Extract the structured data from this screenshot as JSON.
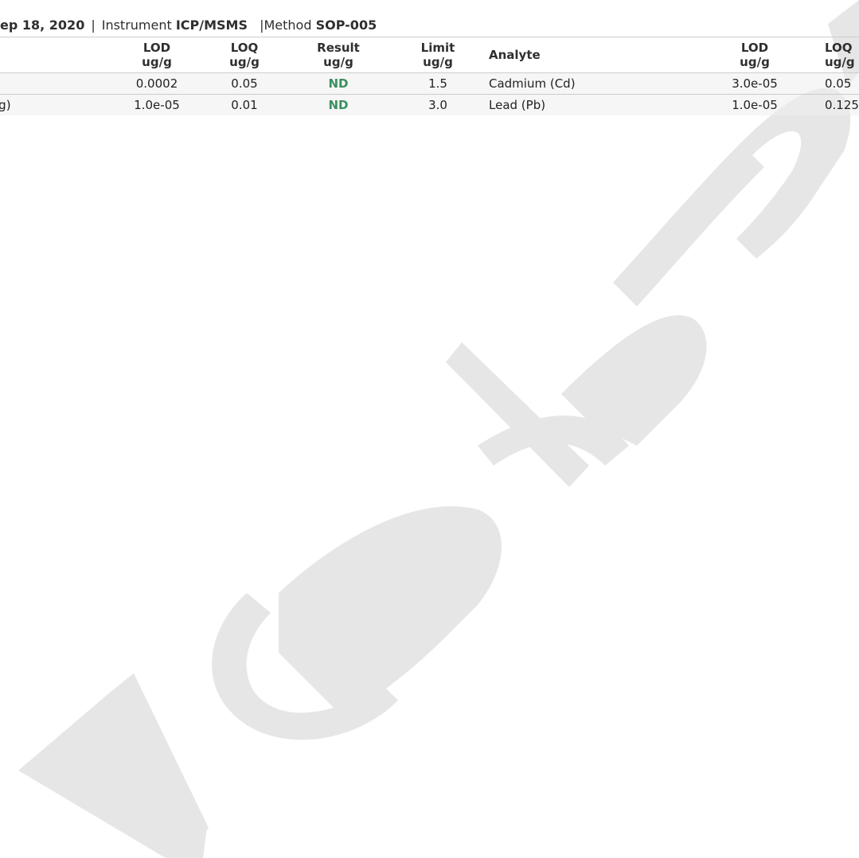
{
  "header": {
    "date": "ep 18, 2020",
    "separator": "|",
    "instrument_label": "Instrument",
    "instrument_value": "ICP/MSMS",
    "method_label": "|Method",
    "method_value": "SOP-005"
  },
  "columns": {
    "lod": {
      "line1": "LOD",
      "line2": "ug/g"
    },
    "loq": {
      "line1": "LOQ",
      "line2": "ug/g"
    },
    "result": {
      "line1": "Result",
      "line2": "ug/g"
    },
    "limit": {
      "line1": "Limit",
      "line2": "ug/g"
    },
    "analyte": "Analyte",
    "lod2": {
      "line1": "LOD",
      "line2": "ug/g"
    },
    "loq2": {
      "line1": "LOQ",
      "line2": "ug/g"
    }
  },
  "rows": [
    {
      "analyte_left": ")",
      "lod": "0.0002",
      "loq": "0.05",
      "result": "ND",
      "limit": "1.5",
      "analyte_right": "Cadmium (Cd)",
      "lod2": "3.0e-05",
      "loq2": "0.05"
    },
    {
      "analyte_left": "lg)",
      "lod": "1.0e-05",
      "loq": "0.01",
      "result": "ND",
      "limit": "3.0",
      "analyte_right": "Lead (Pb)",
      "lod2": "1.0e-05",
      "loq2": "0.125"
    }
  ],
  "watermark": {
    "text": "Vere Labs",
    "color": "#e6e6e6"
  },
  "colors": {
    "nd": "#3a8f5f",
    "rule": "#cccccc"
  }
}
